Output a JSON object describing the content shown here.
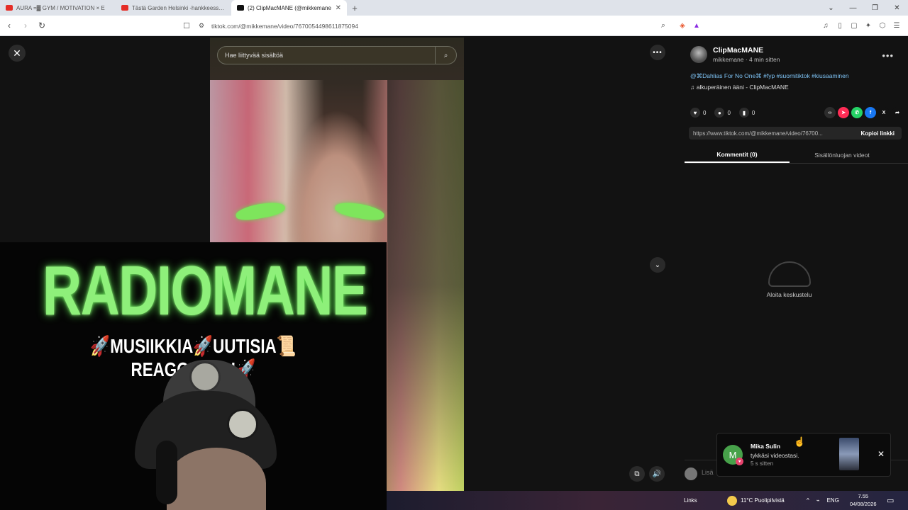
{
  "browser": {
    "tabs": [
      {
        "title": "AURA =▓ GYM / MOTIVATION × E",
        "favicon_color": "#e52d27"
      },
      {
        "title": "Tästä Garden Helsinki -hankkeessa on",
        "favicon_color": "#e52d27"
      },
      {
        "title": "(2) ClipMacMANE (@mikkemane",
        "favicon_color": "#111111"
      }
    ],
    "url": "tiktok.com/@mikkemane/video/7670054498611875094"
  },
  "video": {
    "search_placeholder": "Hae liittyvää sisältöä"
  },
  "overlay": {
    "brand": "RADIOMANE",
    "tagline": "🚀MUSIIKKIA🚀UUTISIA📜REAGOINTIA!🚀"
  },
  "panel": {
    "author_name": "ClipMacMANE",
    "author_sub": "mikkemane · 4 min sitten",
    "description": "@⌘Dahlias For No One⌘ #fyp #suomitiktok #kiusaaminen",
    "sound": "alkuperäinen ääni - ClipMacMANE",
    "likes": "0",
    "comments": "0",
    "saves": "0",
    "link_url": "https://www.tiktok.com/@mikkemane/video/76700...",
    "copy_label": "Kopioi linkki",
    "tab_comments": "Kommentit (0)",
    "tab_creator": "Sisällönluojan videot",
    "empty_text": "Aloita keskustelu",
    "comment_placeholder": "Lisä"
  },
  "toast": {
    "avatar_letter": "M",
    "name": "Mika Sulin",
    "action": "tykkäsi videostasi.",
    "time": "5 s sitten"
  },
  "taskbar": {
    "links": "Links",
    "weather": "11°C  Puolipilvistä",
    "lang": "ENG",
    "time": "7.55",
    "date": "04/08/2026"
  }
}
